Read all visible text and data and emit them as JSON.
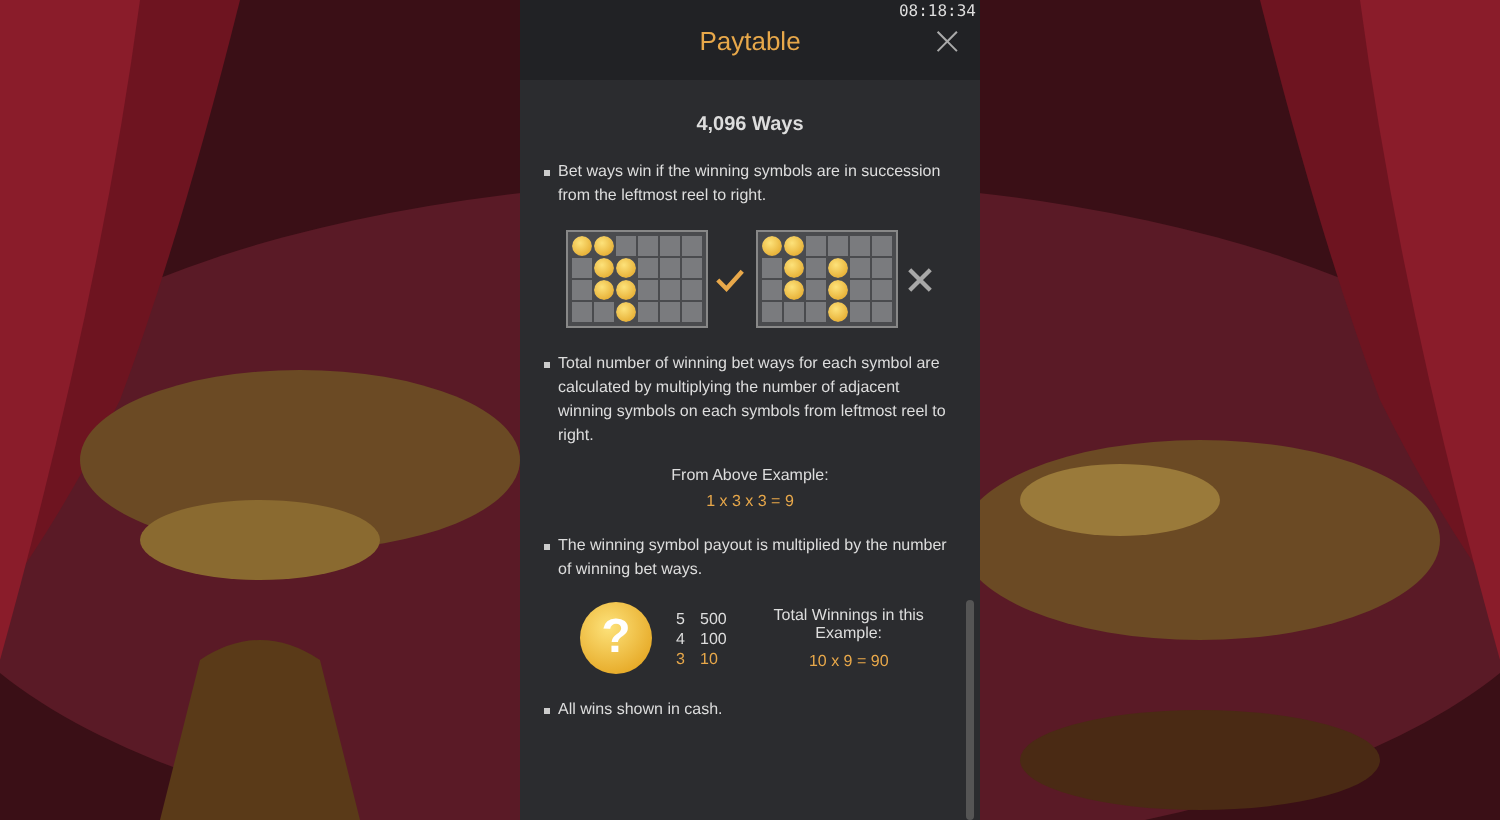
{
  "clock": "08:18:34",
  "header": {
    "title": "Paytable",
    "close": "×"
  },
  "section_title": "4,096 Ways",
  "bullet_1": "Bet ways win if the winning symbols are in succession from the leftmost reel to right.",
  "examples": [
    {
      "valid": true,
      "rows": [
        {
          "cells": [
            {
              "coin": true
            },
            {
              "coin": true
            },
            {
              "coin": false
            },
            {
              "coin": false
            },
            {
              "coin": false
            },
            {
              "coin": false
            }
          ]
        },
        {
          "cells": [
            {
              "coin": false
            },
            {
              "coin": true
            },
            {
              "coin": true
            },
            {
              "coin": false
            },
            {
              "coin": false
            },
            {
              "coin": false
            }
          ]
        },
        {
          "cells": [
            {
              "coin": false
            },
            {
              "coin": true
            },
            {
              "coin": true
            },
            {
              "coin": false
            },
            {
              "coin": false
            },
            {
              "coin": false
            }
          ]
        },
        {
          "cells": [
            {
              "coin": false
            },
            {
              "coin": false
            },
            {
              "coin": true
            },
            {
              "coin": false
            },
            {
              "coin": false
            },
            {
              "coin": false
            }
          ]
        }
      ]
    },
    {
      "valid": false,
      "rows": [
        {
          "cells": [
            {
              "coin": true
            },
            {
              "coin": true
            },
            {
              "coin": false
            },
            {
              "coin": false
            },
            {
              "coin": false
            },
            {
              "coin": false
            }
          ]
        },
        {
          "cells": [
            {
              "coin": false
            },
            {
              "coin": true
            },
            {
              "coin": false
            },
            {
              "coin": true
            },
            {
              "coin": false
            },
            {
              "coin": false
            }
          ]
        },
        {
          "cells": [
            {
              "coin": false
            },
            {
              "coin": true
            },
            {
              "coin": false
            },
            {
              "coin": true
            },
            {
              "coin": false
            },
            {
              "coin": false
            }
          ]
        },
        {
          "cells": [
            {
              "coin": false
            },
            {
              "coin": false
            },
            {
              "coin": false
            },
            {
              "coin": true
            },
            {
              "coin": false
            },
            {
              "coin": false
            }
          ]
        }
      ]
    }
  ],
  "bullet_2": "Total number of winning bet ways for each symbol are calculated by multiplying the number of adjacent winning symbols on each symbols from leftmost reel to right.",
  "example_label": "From Above Example:",
  "example_formula": "1 x 3 x 3 = 9",
  "bullet_3": "The winning symbol payout is multiplied by the number of winning bet ways.",
  "symbol": {
    "glyph": "?"
  },
  "payouts": [
    {
      "count": "5",
      "payout": "500",
      "highlighted": false
    },
    {
      "count": "4",
      "payout": "100",
      "highlighted": false
    },
    {
      "count": "3",
      "payout": "10",
      "highlighted": true
    }
  ],
  "total_label": "Total Winnings in this Example:",
  "total_formula": "10 x 9 = 90",
  "bullet_4": "All wins shown in cash."
}
